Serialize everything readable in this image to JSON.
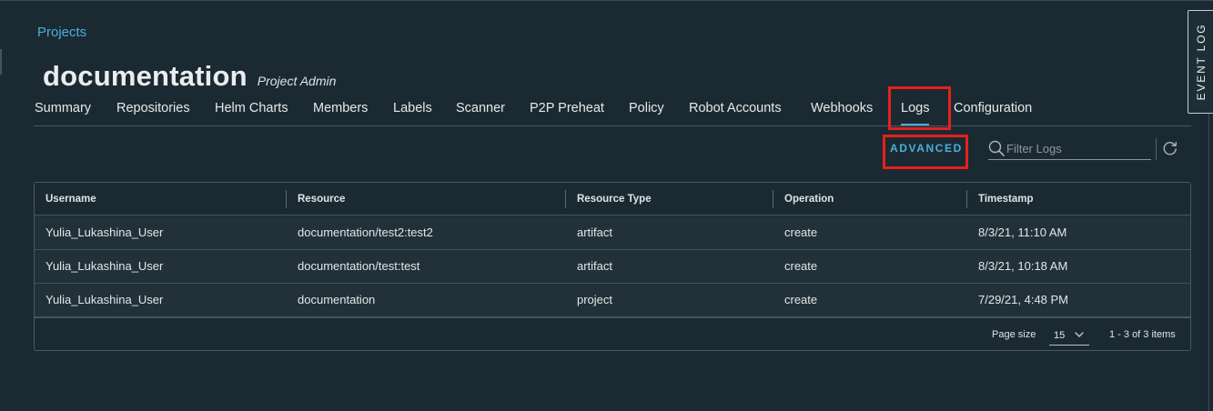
{
  "breadcrumb": {
    "label": "Projects"
  },
  "project": {
    "name": "documentation",
    "role": "Project Admin"
  },
  "tabs": [
    {
      "label": "Summary"
    },
    {
      "label": "Repositories"
    },
    {
      "label": "Helm Charts"
    },
    {
      "label": "Members"
    },
    {
      "label": "Labels"
    },
    {
      "label": "Scanner"
    },
    {
      "label": "P2P Preheat"
    },
    {
      "label": "Policy"
    },
    {
      "label": "Robot Accounts"
    },
    {
      "label": "Webhooks"
    },
    {
      "label": "Logs",
      "active": true
    },
    {
      "label": "Configuration"
    }
  ],
  "toolbar": {
    "advanced_label": "ADVANCED",
    "filter_placeholder": "Filter Logs",
    "filter_icon": "search-icon",
    "refresh_icon": "refresh-icon"
  },
  "grid": {
    "columns": [
      "Username",
      "Resource",
      "Resource Type",
      "Operation",
      "Timestamp"
    ],
    "rows": [
      [
        "Yulia_Lukashina_User",
        "documentation/test2:test2",
        "artifact",
        "create",
        "8/3/21, 11:10 AM"
      ],
      [
        "Yulia_Lukashina_User",
        "documentation/test:test",
        "artifact",
        "create",
        "8/3/21, 10:18 AM"
      ],
      [
        "Yulia_Lukashina_User",
        "documentation",
        "project",
        "create",
        "7/29/21, 4:48 PM"
      ]
    ],
    "footer": {
      "page_size_label": "Page size",
      "page_size_value": "15",
      "pagination_info": "1 - 3 of 3 items"
    }
  },
  "event_log": {
    "label": "EVENT LOG"
  },
  "colors": {
    "accent": "#4aaed9",
    "background": "#1b2a32",
    "highlight": "#e3211c"
  }
}
